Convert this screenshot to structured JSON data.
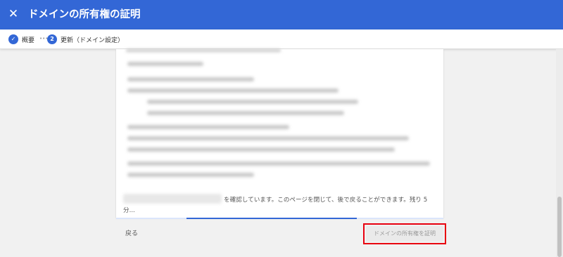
{
  "header": {
    "close_icon": "close-icon",
    "title": "ドメインの所有権の証明"
  },
  "stepper": {
    "steps": [
      {
        "icon": "check-icon",
        "number": "",
        "label": "概要",
        "state": "completed"
      },
      {
        "icon": "",
        "number": "2",
        "label": "更新（ドメイン設定）",
        "state": "active"
      }
    ]
  },
  "card": {
    "status_text": "を確認しています。このページを閉じて、後で戻ることができます。残り 5 分..."
  },
  "footer": {
    "back_label": "戻る",
    "verify_label": "ドメインの所有権を証明"
  },
  "colors": {
    "header": "#3367d6",
    "accent": "#3367d6",
    "highlight_border": "#e8000f"
  }
}
